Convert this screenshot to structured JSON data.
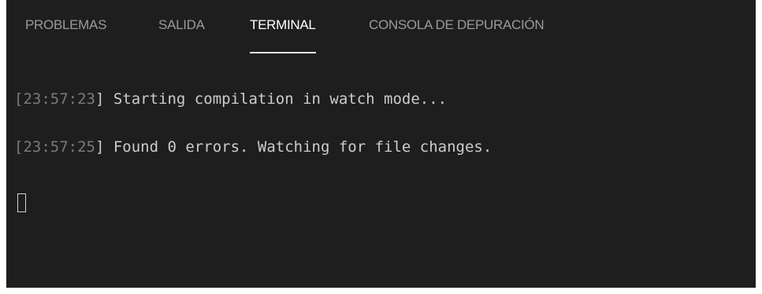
{
  "tabs": [
    {
      "label": "PROBLEMAS",
      "active": false
    },
    {
      "label": "SALIDA",
      "active": false
    },
    {
      "label": "TERMINAL",
      "active": true
    },
    {
      "label": "CONSOLA DE DEPURACIÓN",
      "active": false
    }
  ],
  "terminal": {
    "lines": [
      {
        "open": "[",
        "time": "23:57:23",
        "close": "]",
        "message": " Starting compilation in watch mode..."
      },
      {
        "open": "[",
        "time": "23:57:25",
        "close": "]",
        "message": " Found 0 errors. Watching for file changes."
      }
    ]
  },
  "colors": {
    "background": "#1e1e1e",
    "active_tab": "#ffffff",
    "inactive_tab": "#9a9a9a",
    "timestamp": "#7a7a7a",
    "text": "#cccccc"
  }
}
